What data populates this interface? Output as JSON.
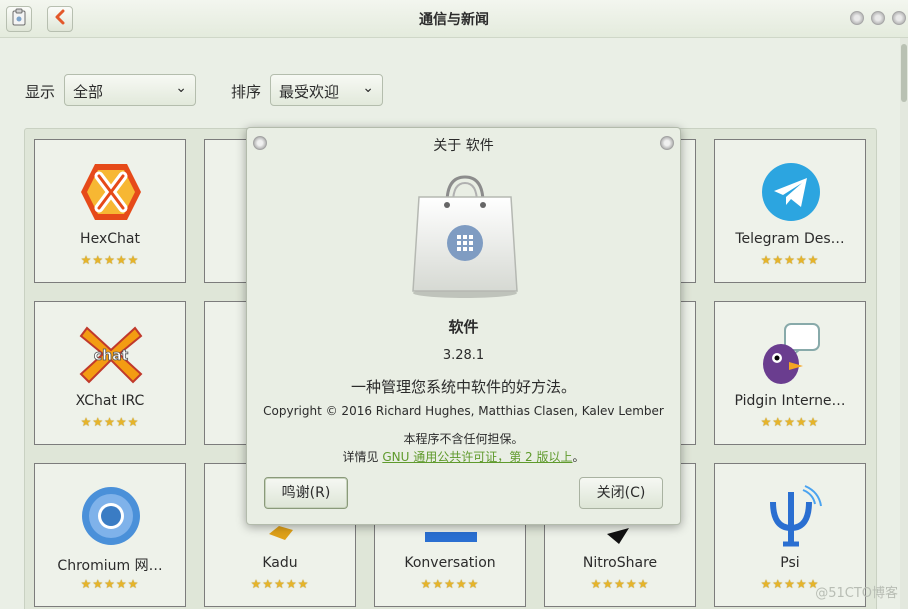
{
  "window": {
    "title": "通信与新闻"
  },
  "filters": {
    "show_label": "显示",
    "show_value": "全部",
    "sort_label": "排序",
    "sort_value": "最受欢迎"
  },
  "apps": [
    {
      "name": "HexChat",
      "icon": "hexchat-icon",
      "stars": "★★★★★"
    },
    {
      "name": "Telegram Des…",
      "icon": "telegram-icon",
      "stars": "★★★★★"
    },
    {
      "name": "XChat IRC",
      "icon": "xchat-icon",
      "stars": "★★★★★"
    },
    {
      "name": "Pidgin Interne…",
      "icon": "pidgin-icon",
      "stars": "★★★★★"
    },
    {
      "name": "Chromium 网…",
      "icon": "chromium-icon",
      "stars": "★★★★★"
    },
    {
      "name": "Kadu",
      "icon": "kadu-icon",
      "stars": "★★★★★"
    },
    {
      "name": "Konversation",
      "icon": "konversation-icon",
      "stars": "★★★★★"
    },
    {
      "name": "NitroShare",
      "icon": "nitroshare-icon",
      "stars": "★★★★★"
    },
    {
      "name": "Psi",
      "icon": "psi-icon",
      "stars": "★★★★★"
    }
  ],
  "about_dialog": {
    "title": "关于 软件",
    "app_name": "软件",
    "version": "3.28.1",
    "comment": "一种管理您系统中软件的好方法。",
    "copyright": "Copyright © 2016 Richard Hughes, Matthias Clasen, Kalev Lember",
    "warranty": "本程序不含任何担保。",
    "license_prefix": "详情见 ",
    "license_link": "GNU 通用公共许可证，第 2 版以上",
    "license_suffix": "。",
    "credits_button": "鸣谢(R)",
    "close_button": "关闭(C)"
  },
  "watermark": "@51CTO博客",
  "colors": {
    "accent_link": "#5f9a2c",
    "star": "#e6b42a",
    "background": "#eaefe6"
  }
}
